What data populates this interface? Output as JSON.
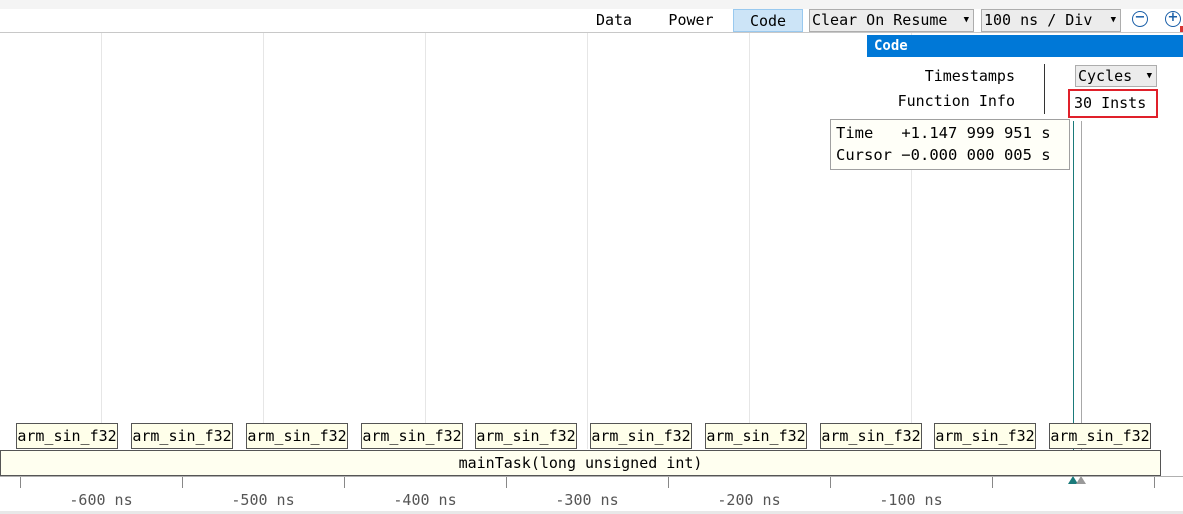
{
  "toolbar": {
    "tabs": [
      {
        "label": "Data",
        "active": false
      },
      {
        "label": "Power",
        "active": false
      },
      {
        "label": "Code",
        "active": true
      }
    ],
    "clear_mode": "Clear On Resume",
    "time_scale": "100 ns / Div",
    "zoom_out_icon": "zoom-out-icon",
    "zoom_in_icon": "zoom-in-icon"
  },
  "code_panel": {
    "title": "Code",
    "timestamps_label": "Timestamps",
    "timestamps_value": "Cycles",
    "function_info_label": "Function Info",
    "function_info_value": "30 Insts"
  },
  "tooltip": {
    "time_line": "Time   +1.147 999 951 s",
    "cursor_line": "Cursor −0.000 000 005 s"
  },
  "functions": [
    "arm_sin_f32",
    "arm_sin_f32",
    "arm_sin_f32",
    "arm_sin_f32",
    "arm_sin_f32",
    "arm_sin_f32",
    "arm_sin_f32",
    "arm_sin_f32",
    "arm_sin_f32",
    "arm_sin_f32"
  ],
  "main_task": "mainTask(long unsigned int)",
  "ruler_labels": [
    "-600 ns",
    "-500 ns",
    "-400 ns",
    "-300 ns",
    "-200 ns",
    "-100 ns"
  ],
  "colors": {
    "accent": "#0078d7",
    "active_tab": "#cce4f7",
    "highlight_border": "#e0202a",
    "cursor": "#1a7a7a"
  }
}
